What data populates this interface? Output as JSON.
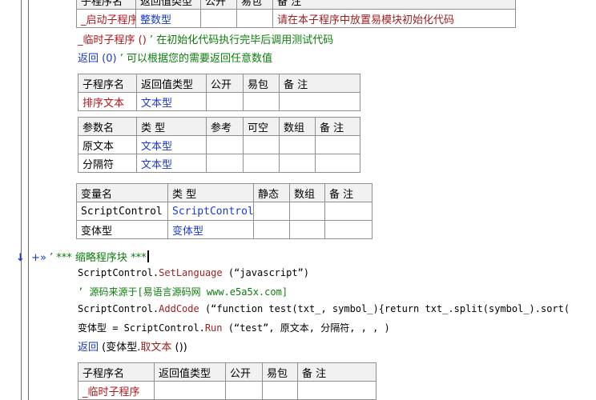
{
  "colors": {
    "keyword": "#1a3ad0",
    "name": "#b3161a",
    "comment": "#0b7d0b",
    "method": "#9b1d1d"
  },
  "table0": {
    "header": [
      "子程序名",
      "返回值类型",
      "公开",
      "易包",
      "备 注"
    ],
    "row": [
      "_启动子程序",
      "整数型",
      "",
      "",
      "请在本子程序中放置易模块初始化代码"
    ]
  },
  "lines": {
    "l1_name": "_临时子程序",
    "l1_paren": " ()",
    "l1_comment": "  ’ 在初始化代码执行完毕后调用测试代码",
    "l2_kw": "返回 (0)",
    "l2_comment": "  ’ 可以根据您的需要返回任意数值"
  },
  "table1": {
    "header": [
      "子程序名",
      "返回值类型",
      "公开",
      "易包",
      "备 注"
    ],
    "row": [
      "排序文本",
      "文本型",
      "",
      "",
      ""
    ]
  },
  "table2": {
    "header": [
      "参数名",
      "类 型",
      "参考",
      "可空",
      "数组",
      "备 注"
    ],
    "rows": [
      [
        "原文本",
        "文本型",
        "",
        "",
        "",
        ""
      ],
      [
        "分隔符",
        "文本型",
        "",
        "",
        "",
        ""
      ]
    ]
  },
  "table3": {
    "header": [
      "变量名",
      "类 型",
      "静态",
      "数组",
      "备 注"
    ],
    "rows": [
      [
        "ScriptControl",
        "ScriptControl",
        "",
        "",
        ""
      ],
      [
        "变体型",
        "变体型",
        "",
        "",
        ""
      ]
    ]
  },
  "fold": {
    "arrow": "↓",
    "plus": "+»",
    "text": " ’ *** 缩略程序块 ***"
  },
  "code": {
    "c1_obj": "ScriptControl.",
    "c1_method": "SetLanguage",
    "c1_args": " (“javascript”)",
    "c2_comment": "’ 源码来源于[易语言源码网 www.e5a5x.com]",
    "c3_obj": "ScriptControl.",
    "c3_method": "AddCode",
    "c3_args": " (“function test(txt_, symbol_){return txt_.split(symbol_).sort(",
    "c4_lhs": "变体型 = ScriptControl.",
    "c4_method": "Run",
    "c4_args": " (“test”, 原文本, 分隔符, , , )",
    "c5_kw": "返回",
    "c5_mid": " (变体型.",
    "c5_method": "取文本",
    "c5_end": " ())"
  },
  "table4": {
    "header": [
      "子程序名",
      "返回值类型",
      "公开",
      "易包",
      "备 注"
    ],
    "row": [
      "_临时子程序",
      "",
      "",
      "",
      ""
    ]
  }
}
